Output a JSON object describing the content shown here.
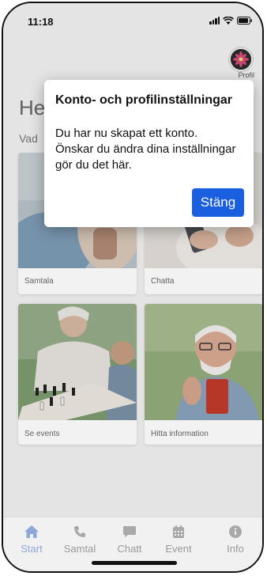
{
  "status_bar": {
    "time": "11:18"
  },
  "header": {
    "avatar_label": "Profil",
    "greeting": "He",
    "subtitle": "Vad"
  },
  "cards": [
    {
      "label": "Samtala"
    },
    {
      "label": "Chatta"
    },
    {
      "label": "Se events"
    },
    {
      "label": "Hitta information"
    }
  ],
  "dialog": {
    "title": "Konto- och profilinställningar",
    "body": "Du har nu skapat ett konto. Önskar du ändra dina inställningar gör du det här.",
    "button": "Stäng"
  },
  "tabs": [
    {
      "label": "Start",
      "icon": "home-icon",
      "active": true
    },
    {
      "label": "Samtal",
      "icon": "phone-icon"
    },
    {
      "label": "Chatt",
      "icon": "chat-icon"
    },
    {
      "label": "Event",
      "icon": "calendar-icon"
    },
    {
      "label": "Info",
      "icon": "info-icon"
    }
  ],
  "colors": {
    "accent": "#1a5fe0",
    "active_tab": "#8fa7d8"
  }
}
